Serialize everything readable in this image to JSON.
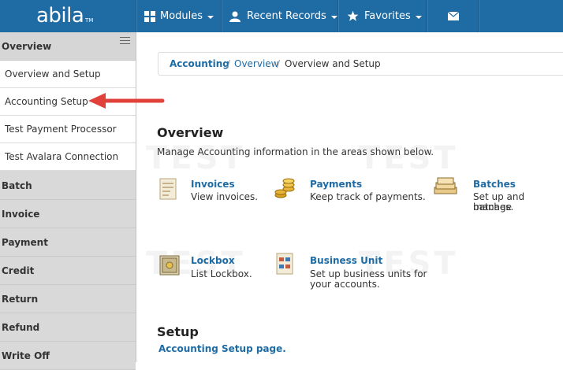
{
  "header": {
    "logo": "abila",
    "logo_tm": "TM",
    "nav": [
      {
        "label": "Modules",
        "icon": "grid-icon"
      },
      {
        "label": "Recent Records",
        "icon": "user-icon"
      },
      {
        "label": "Favorites",
        "icon": "star-icon"
      }
    ],
    "mail_icon": "envelope-icon"
  },
  "sidebar": {
    "header": "Overview",
    "subitems": [
      "Overview and Setup",
      "Accounting Setup",
      "Test Payment Processor",
      "Test Avalara Connection"
    ],
    "sections": [
      "Batch",
      "Invoice",
      "Payment",
      "Credit",
      "Return",
      "Refund",
      "Write Off"
    ]
  },
  "breadcrumb": {
    "item1": "Accounting",
    "item2": "Overview",
    "current": "Overview and Setup",
    "separator": "/"
  },
  "overview": {
    "title": "Overview",
    "description": "Manage Accounting information in the areas shown below.",
    "cards": [
      {
        "title": "Invoices",
        "desc1": "View invoices.",
        "desc2": ""
      },
      {
        "title": "Payments",
        "desc1": "Keep track of payments.",
        "desc2": ""
      },
      {
        "title": "Batches",
        "desc1": "Set up and manage",
        "desc2": "batches."
      },
      {
        "title": "Lockbox",
        "desc1": "List Lockbox.",
        "desc2": ""
      },
      {
        "title": "Business Unit",
        "desc1": "Set up business units for",
        "desc2": "your accounts."
      }
    ]
  },
  "setup": {
    "title": "Setup",
    "link": "Accounting Setup page."
  },
  "watermark": "TEST",
  "colors": {
    "nav": "#1f6ba4",
    "link": "#1f6ba4",
    "arrow": "#e0413a"
  }
}
